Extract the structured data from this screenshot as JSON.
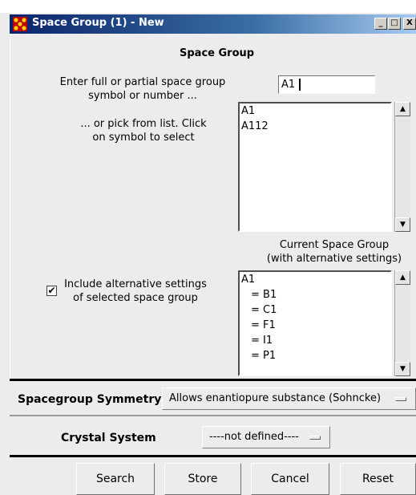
{
  "window": {
    "title": "Space Group (1) - New"
  },
  "titlebar_buttons": {
    "minimize": "_",
    "maximize": "□",
    "close": "X"
  },
  "space_group": {
    "heading": "Space Group",
    "enter_label_line1": "Enter full or partial space group",
    "enter_label_line2": "symbol or number ...",
    "symbol_input_value": "A1",
    "pick_label_line1": "... or pick from list. Click",
    "pick_label_line2": "on symbol to select",
    "pick_list": [
      "A1",
      "A112"
    ],
    "current_heading_line1": "Current Space Group",
    "current_heading_line2": "(with alternative settings)",
    "current_list": [
      "A1",
      "= B1",
      "= C1",
      "= F1",
      "= I1",
      "= P1"
    ],
    "include_alt_checked": true,
    "include_alt_line1": "Include alternative settings",
    "include_alt_line2": "of selected space group"
  },
  "symmetry": {
    "label": "Spacegroup Symmetry",
    "value": "Allows enantiopure substance (Sohncke)"
  },
  "crystal": {
    "label": "Crystal System",
    "value": "----not defined----"
  },
  "buttons": {
    "search": "Search",
    "store": "Store",
    "cancel": "Cancel",
    "reset": "Reset"
  },
  "icons": {
    "title": "app-logo-icon",
    "check": "✔"
  }
}
